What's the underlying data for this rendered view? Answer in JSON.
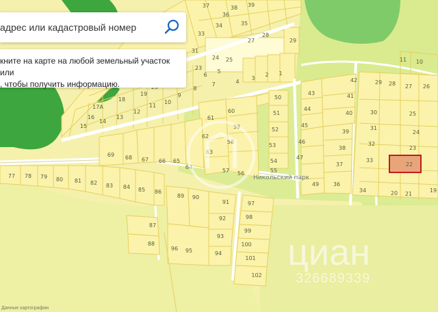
{
  "search": {
    "placeholder": "адрес или кадастровый номер",
    "icon": "search-icon"
  },
  "hint": {
    "text": "кните на карте на любой земельный участок или\n, чтобы получить информацию."
  },
  "street_label": "Никольский парк",
  "watermark": {
    "brand": "циан",
    "phone": "326689339"
  },
  "bottom_note": "Данные картографии",
  "highlighted_parcel": "22",
  "colors": {
    "background": "#f4f0a8",
    "parcel_fill": "#fbf2a9",
    "parcel_stroke": "#e6cf60",
    "forest": "#3aa53c",
    "meadow": "#d6ea8a",
    "selected_stroke": "#c21b1b",
    "selected_fill": "#e8a878"
  },
  "parcels": [
    {
      "id": "p37",
      "label": "37"
    },
    {
      "id": "p38",
      "label": "38"
    },
    {
      "id": "p39",
      "label": "39"
    },
    {
      "id": "p36a",
      "label": "36"
    },
    {
      "id": "p35",
      "label": "35"
    },
    {
      "id": "p34a",
      "label": "34"
    },
    {
      "id": "p33a",
      "label": "33"
    },
    {
      "id": "p32a",
      "label": "32"
    },
    {
      "id": "p31a",
      "label": "31"
    },
    {
      "id": "p30a",
      "label": "30"
    },
    {
      "id": "p28a",
      "label": "28"
    },
    {
      "id": "p27a",
      "label": "27"
    },
    {
      "id": "p29a",
      "label": "29"
    },
    {
      "id": "p26a",
      "label": "26"
    },
    {
      "id": "p25a",
      "label": "25"
    },
    {
      "id": "p24a",
      "label": "24"
    },
    {
      "id": "p23a",
      "label": "23"
    },
    {
      "id": "p22a",
      "label": "22"
    },
    {
      "id": "p21a",
      "label": "21"
    },
    {
      "id": "p20a",
      "label": "20"
    },
    {
      "id": "p19a",
      "label": "19"
    },
    {
      "id": "p18a",
      "label": "18"
    },
    {
      "id": "p17A",
      "label": "17А"
    },
    {
      "id": "p16a",
      "label": "16"
    },
    {
      "id": "p15a",
      "label": "15"
    },
    {
      "id": "p14a",
      "label": "14"
    },
    {
      "id": "p13a",
      "label": "13"
    },
    {
      "id": "p12a",
      "label": "12"
    },
    {
      "id": "p11a",
      "label": "11"
    },
    {
      "id": "p10a",
      "label": "10"
    },
    {
      "id": "p9a",
      "label": "9"
    },
    {
      "id": "p8a",
      "label": "8"
    },
    {
      "id": "p7a",
      "label": "7"
    },
    {
      "id": "p6a",
      "label": "6"
    },
    {
      "id": "p5a",
      "label": "5"
    },
    {
      "id": "p4a",
      "label": "4"
    },
    {
      "id": "p3a",
      "label": "3"
    },
    {
      "id": "p2a",
      "label": "2"
    },
    {
      "id": "p1a",
      "label": "1"
    },
    {
      "id": "p61",
      "label": "61"
    },
    {
      "id": "p60",
      "label": "60"
    },
    {
      "id": "p59",
      "label": "59"
    },
    {
      "id": "p58",
      "label": "58"
    },
    {
      "id": "p62",
      "label": "62"
    },
    {
      "id": "p63",
      "label": "63"
    },
    {
      "id": "p64",
      "label": "64"
    },
    {
      "id": "p65",
      "label": "65"
    },
    {
      "id": "p66",
      "label": "66"
    },
    {
      "id": "p67",
      "label": "67"
    },
    {
      "id": "p68",
      "label": "68"
    },
    {
      "id": "p69",
      "label": "69"
    },
    {
      "id": "p57",
      "label": "57"
    },
    {
      "id": "p56",
      "label": "56"
    },
    {
      "id": "p50",
      "label": "50"
    },
    {
      "id": "p51",
      "label": "51"
    },
    {
      "id": "p52",
      "label": "52"
    },
    {
      "id": "p53",
      "label": "53"
    },
    {
      "id": "p54",
      "label": "54"
    },
    {
      "id": "p55",
      "label": "55"
    },
    {
      "id": "p43",
      "label": "43"
    },
    {
      "id": "p44",
      "label": "44"
    },
    {
      "id": "p45",
      "label": "45"
    },
    {
      "id": "p46",
      "label": "46"
    },
    {
      "id": "p47",
      "label": "47"
    },
    {
      "id": "p49",
      "label": "49"
    },
    {
      "id": "p36b",
      "label": "36"
    },
    {
      "id": "p37b",
      "label": "37"
    },
    {
      "id": "p38b",
      "label": "38"
    },
    {
      "id": "p39b",
      "label": "39"
    },
    {
      "id": "p40",
      "label": "40"
    },
    {
      "id": "p41",
      "label": "41"
    },
    {
      "id": "p42",
      "label": "42"
    },
    {
      "id": "p33b",
      "label": "33"
    },
    {
      "id": "p34b",
      "label": "34"
    },
    {
      "id": "p32b",
      "label": "32"
    },
    {
      "id": "p31b",
      "label": "31"
    },
    {
      "id": "p30b",
      "label": "30"
    },
    {
      "id": "p29b",
      "label": "29"
    },
    {
      "id": "p28b",
      "label": "28"
    },
    {
      "id": "p27b",
      "label": "27"
    },
    {
      "id": "p26b",
      "label": "26"
    },
    {
      "id": "p25b",
      "label": "25"
    },
    {
      "id": "p24b",
      "label": "24"
    },
    {
      "id": "p23b",
      "label": "23"
    },
    {
      "id": "p22b",
      "label": "22"
    },
    {
      "id": "p21b",
      "label": "21"
    },
    {
      "id": "p20b",
      "label": "20"
    },
    {
      "id": "p19b",
      "label": "19"
    },
    {
      "id": "p11b",
      "label": "11"
    },
    {
      "id": "p10b",
      "label": "10"
    },
    {
      "id": "p77",
      "label": "77"
    },
    {
      "id": "p78",
      "label": "78"
    },
    {
      "id": "p79",
      "label": "79"
    },
    {
      "id": "p80",
      "label": "80"
    },
    {
      "id": "p81",
      "label": "81"
    },
    {
      "id": "p82",
      "label": "82"
    },
    {
      "id": "p83",
      "label": "83"
    },
    {
      "id": "p84",
      "label": "84"
    },
    {
      "id": "p85",
      "label": "85"
    },
    {
      "id": "p86",
      "label": "86"
    },
    {
      "id": "p87",
      "label": "87"
    },
    {
      "id": "p88",
      "label": "88"
    },
    {
      "id": "p89",
      "label": "89"
    },
    {
      "id": "p90",
      "label": "90"
    },
    {
      "id": "p91",
      "label": "91"
    },
    {
      "id": "p92",
      "label": "92"
    },
    {
      "id": "p93",
      "label": "93"
    },
    {
      "id": "p94",
      "label": "94"
    },
    {
      "id": "p95",
      "label": "95"
    },
    {
      "id": "p96",
      "label": "96"
    },
    {
      "id": "p97",
      "label": "97"
    },
    {
      "id": "p98",
      "label": "98"
    },
    {
      "id": "p99",
      "label": "99"
    },
    {
      "id": "p100",
      "label": "100"
    },
    {
      "id": "p101",
      "label": "101"
    },
    {
      "id": "p102",
      "label": "102"
    }
  ]
}
